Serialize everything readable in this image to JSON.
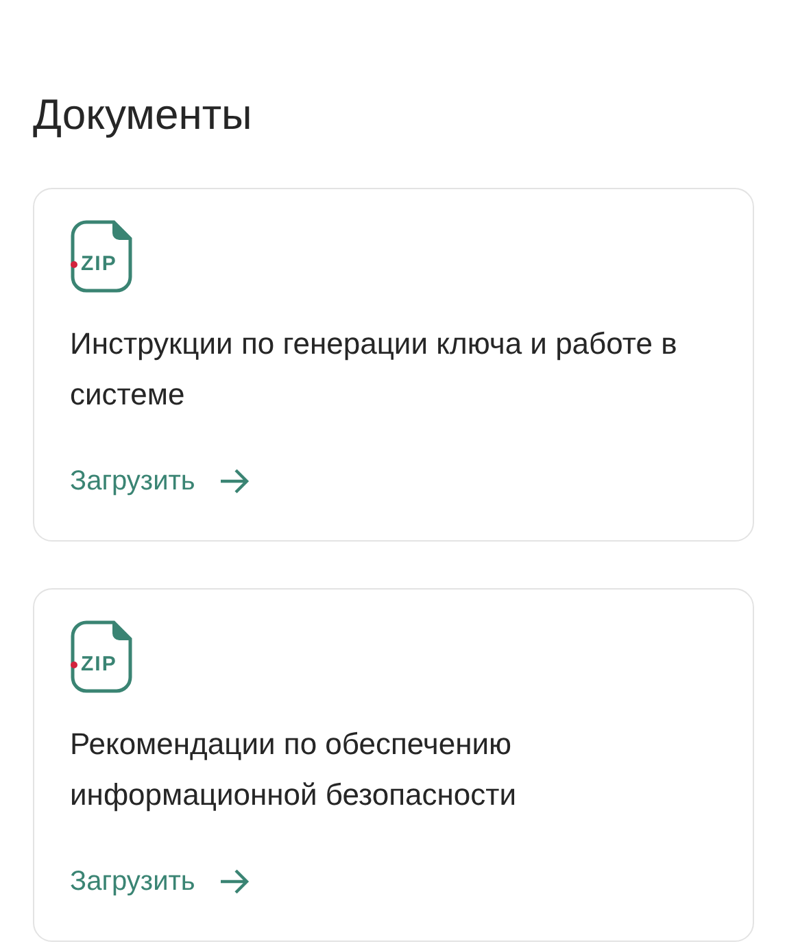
{
  "title": "Документы",
  "documents": [
    {
      "file_type": "ZIP",
      "name": "Инструкции по генерации ключа и работе в системе",
      "action": "Загрузить"
    },
    {
      "file_type": "ZIP",
      "name": "Рекомендации по обеспечению информационной безопасности",
      "action": "Загрузить"
    }
  ]
}
